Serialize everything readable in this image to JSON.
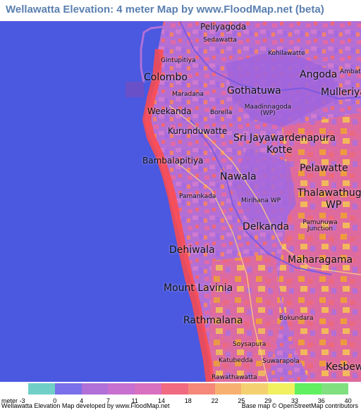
{
  "title": "Wellawatta Elevation: 4 meter Map by www.FloodMap.net (beta)",
  "map": {
    "colors": {
      "sea": "#4b58e0",
      "land_low": "#b36fd4",
      "land_mid": "#f06878",
      "land_high": "#f4a030",
      "coast": "#ff4a4a"
    },
    "place_labels": [
      {
        "name": "Peliyagoda",
        "size": "mid"
      },
      {
        "name": "Sedawatta",
        "size": "small"
      },
      {
        "name": "Kohilawatte",
        "size": "small"
      },
      {
        "name": "Gintupitiya",
        "size": "small"
      },
      {
        "name": "Colombo",
        "size": "big"
      },
      {
        "name": "Angoda",
        "size": "big"
      },
      {
        "name": "Ambatal",
        "size": "small"
      },
      {
        "name": "Maradana",
        "size": "small"
      },
      {
        "name": "Gothatuwa",
        "size": "big"
      },
      {
        "name": "Mulleriyaw",
        "size": "big"
      },
      {
        "name": "Weekanda",
        "size": "mid"
      },
      {
        "name": "Borella",
        "size": "small"
      },
      {
        "name": "Maadinnagoda (WP)",
        "size": "small"
      },
      {
        "name": "Kurunduwatte",
        "size": "mid"
      },
      {
        "name": "Sri Jayawardenapura",
        "size": "big"
      },
      {
        "name": "Kotte",
        "size": "big"
      },
      {
        "name": "Bambalapitiya",
        "size": "mid"
      },
      {
        "name": "Pelawatte",
        "size": "big"
      },
      {
        "name": "Nawala",
        "size": "big"
      },
      {
        "name": "Thalawathugoda",
        "size": "big"
      },
      {
        "name": "WP",
        "size": "big"
      },
      {
        "name": "Pamankada",
        "size": "small"
      },
      {
        "name": "Mirihana WP",
        "size": "small"
      },
      {
        "name": "Delkanda",
        "size": "big"
      },
      {
        "name": "Pamunuwa Junction",
        "size": "small"
      },
      {
        "name": "Dehiwala",
        "size": "big"
      },
      {
        "name": "Maharagama",
        "size": "big"
      },
      {
        "name": "Mount Lavinia",
        "size": "big"
      },
      {
        "name": "Rathmalana",
        "size": "big"
      },
      {
        "name": "Bokundara",
        "size": "small"
      },
      {
        "name": "Soysapura",
        "size": "small"
      },
      {
        "name": "Katubedda",
        "size": "small"
      },
      {
        "name": "Suwarapola",
        "size": "small"
      },
      {
        "name": "Kesbewa",
        "size": "big"
      },
      {
        "name": "Rawathawatta",
        "size": "small"
      }
    ],
    "marker": {
      "label": "current-location",
      "color": "#e23a2a"
    }
  },
  "legend": {
    "unit_label": "meter",
    "ticks": [
      "-3",
      "0",
      "4",
      "7",
      "11",
      "14",
      "18",
      "22",
      "25",
      "29",
      "33",
      "36",
      "40"
    ],
    "colors": [
      "#70d0c8",
      "#7a70ea",
      "#b070d8",
      "#c870d0",
      "#d870c0",
      "#f06a80",
      "#f6887a",
      "#f8b070",
      "#f4d070",
      "#f0f060",
      "#60f060",
      "#80e080"
    ]
  },
  "credits": {
    "left": "Wellawatta Elevation Map developed by www.FloodMap.net",
    "right": "Base map © OpenStreetMap contributors"
  }
}
